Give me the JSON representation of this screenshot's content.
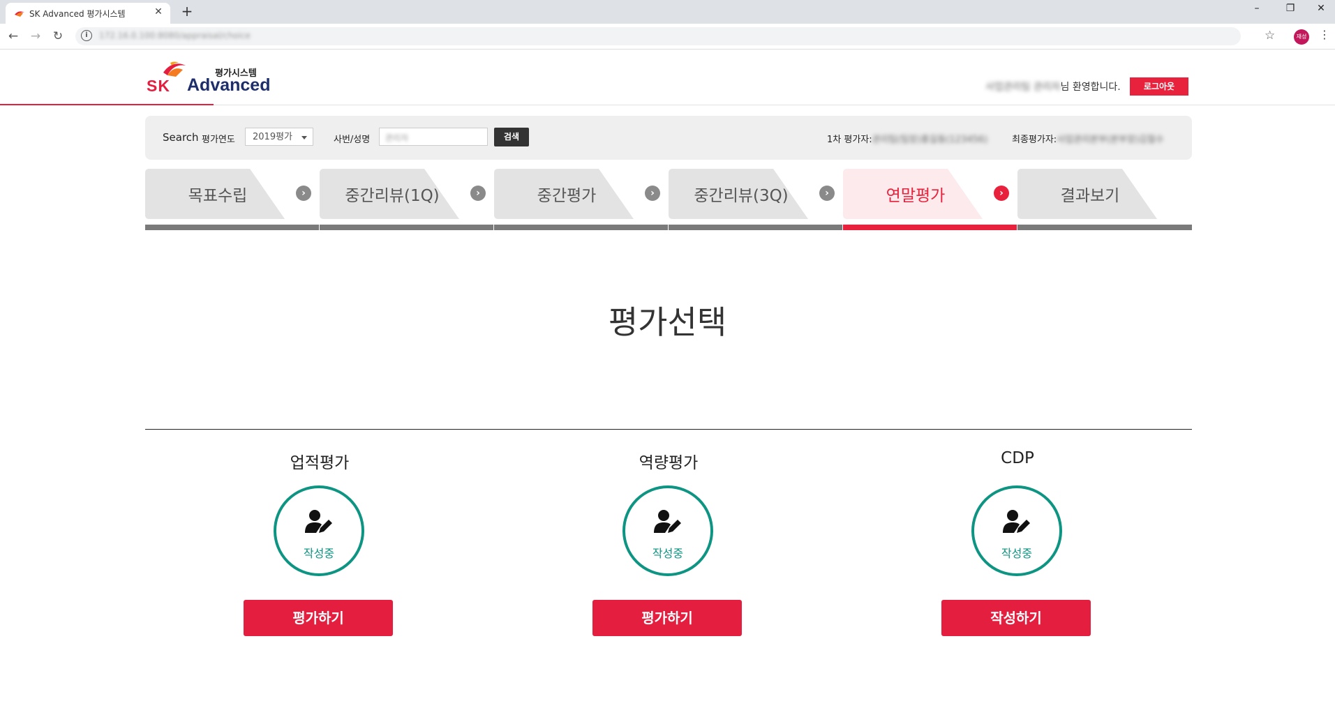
{
  "browser": {
    "tab_title": "SK Advanced 평가시스템",
    "url": "172.16.0.100:8080/appraisal/choice"
  },
  "header": {
    "logo_brand": "SK",
    "logo_system": "평가시스템",
    "logo_name": "Advanced",
    "welcome_user": "사업관리팀 관리자",
    "welcome_suffix": "님 환영합니다.",
    "logout_label": "로그아웃"
  },
  "search": {
    "label": "Search",
    "year_label": "평가연도",
    "year_value": "2019평가",
    "emp_label": "사번/성명",
    "emp_value": "관리자",
    "search_button": "검색",
    "first_rater_label": "1차 평가자:",
    "first_rater_value": "관리팀(팀장)홍길동(123456)",
    "final_rater_label": "최종평가자:",
    "final_rater_value": "사업관리본부(본부장)김철수"
  },
  "steps": [
    {
      "label": "목표수립",
      "active": false
    },
    {
      "label": "중간리뷰(1Q)",
      "active": false
    },
    {
      "label": "중간평가",
      "active": false
    },
    {
      "label": "중간리뷰(3Q)",
      "active": false
    },
    {
      "label": "연말평가",
      "active": true
    },
    {
      "label": "결과보기",
      "active": false
    }
  ],
  "page_title": "평가선택",
  "cards": [
    {
      "title": "업적평가",
      "icon": "user-edit-icon",
      "status": "작성중",
      "button": "평가하기"
    },
    {
      "title": "역량평가",
      "icon": "user-edit-icon",
      "status": "작성중",
      "button": "평가하기"
    },
    {
      "title": "CDP",
      "icon": "user-edit-icon",
      "status": "작성중",
      "button": "작성하기"
    }
  ],
  "colors": {
    "brand_red": "#e41e3f",
    "status_teal": "#0e9482",
    "inactive_bar": "#7a7a7a"
  }
}
